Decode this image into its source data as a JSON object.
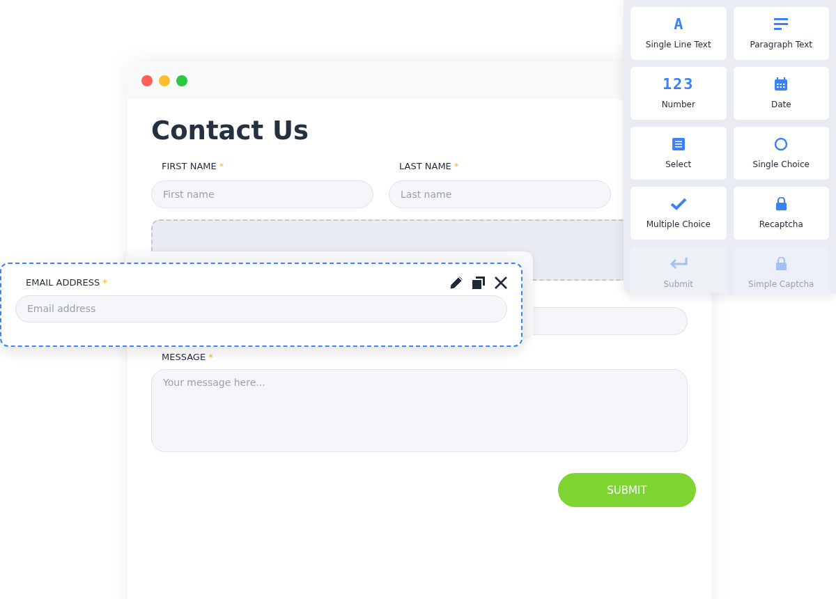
{
  "form_window": {
    "title": "Contact Us",
    "name_fields": [
      {
        "label": "FIRST NAME",
        "required_mark": "*",
        "placeholder": "First name"
      },
      {
        "label": "LAST NAME",
        "required_mark": "*",
        "placeholder": "Last name"
      }
    ],
    "message_field": {
      "label": "MESSAGE",
      "required_mark": "*",
      "placeholder": "Your message here..."
    },
    "submit_button": "SUBMIT"
  },
  "dragged_field": {
    "label": "EMAIL ADDRESS",
    "required_mark": "*",
    "placeholder": "Email address"
  },
  "field_palette": [
    {
      "kind": "letter",
      "glyph": "A",
      "label": "Single Line Text",
      "disabled": false
    },
    {
      "kind": "paragraph",
      "label": "Paragraph Text",
      "disabled": false
    },
    {
      "kind": "digits",
      "glyph": "123",
      "label": "Number",
      "disabled": false
    },
    {
      "kind": "calendar",
      "label": "Date",
      "disabled": false
    },
    {
      "kind": "list",
      "label": "Select",
      "disabled": false
    },
    {
      "kind": "radio",
      "label": "Single Choice",
      "disabled": false
    },
    {
      "kind": "check",
      "label": "Multiple Choice",
      "disabled": false
    },
    {
      "kind": "lock",
      "label": "Recaptcha",
      "disabled": false
    },
    {
      "kind": "enter",
      "label": "Submit",
      "disabled": true
    },
    {
      "kind": "lock",
      "label": "Simple Captcha",
      "disabled": true
    }
  ]
}
